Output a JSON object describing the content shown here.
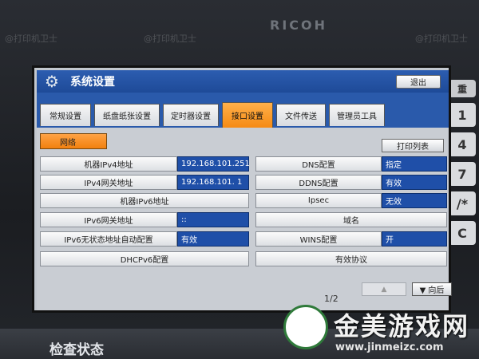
{
  "device": {
    "brand": "RICOH",
    "watermark": "@打印机卫士"
  },
  "keypad": [
    "重",
    "1",
    "4",
    "7",
    "/*",
    "C"
  ],
  "window": {
    "title": "系统设置",
    "exit_label": "退出"
  },
  "tabs": [
    {
      "label": "常规设置",
      "active": false
    },
    {
      "label": "纸盘纸张设置",
      "active": false
    },
    {
      "label": "定时器设置",
      "active": false
    },
    {
      "label": "接口设置",
      "active": true
    },
    {
      "label": "文件传送",
      "active": false
    },
    {
      "label": "管理员工具",
      "active": false
    }
  ],
  "content": {
    "network_button": "网络",
    "print_list_button": "打印列表",
    "left_rows": [
      {
        "label": "机器IPv4地址",
        "value": "192.168.101.251"
      },
      {
        "label": "IPv4网关地址",
        "value": "192.168.101.  1"
      },
      {
        "label": "机器IPv6地址",
        "value": ""
      },
      {
        "label": "IPv6网关地址",
        "value": "::"
      },
      {
        "label": "IPv6无状态地址自动配置",
        "value": "有效"
      },
      {
        "label": "DHCPv6配置",
        "value": ""
      }
    ],
    "right_rows": [
      {
        "label": "DNS配置",
        "value": "指定"
      },
      {
        "label": "DDNS配置",
        "value": "有效"
      },
      {
        "label": "Ipsec",
        "value": "无效"
      },
      {
        "label": "域名",
        "value": ""
      },
      {
        "label": "WINS配置",
        "value": "开"
      },
      {
        "label": "有效协议",
        "value": ""
      }
    ],
    "pager": "1/2",
    "back_button": "▼ 向后"
  },
  "status_bar": {
    "label": "检查状态"
  },
  "site_logo": {
    "name": "金美游戏网",
    "url": "www.jinmeizc.com"
  }
}
